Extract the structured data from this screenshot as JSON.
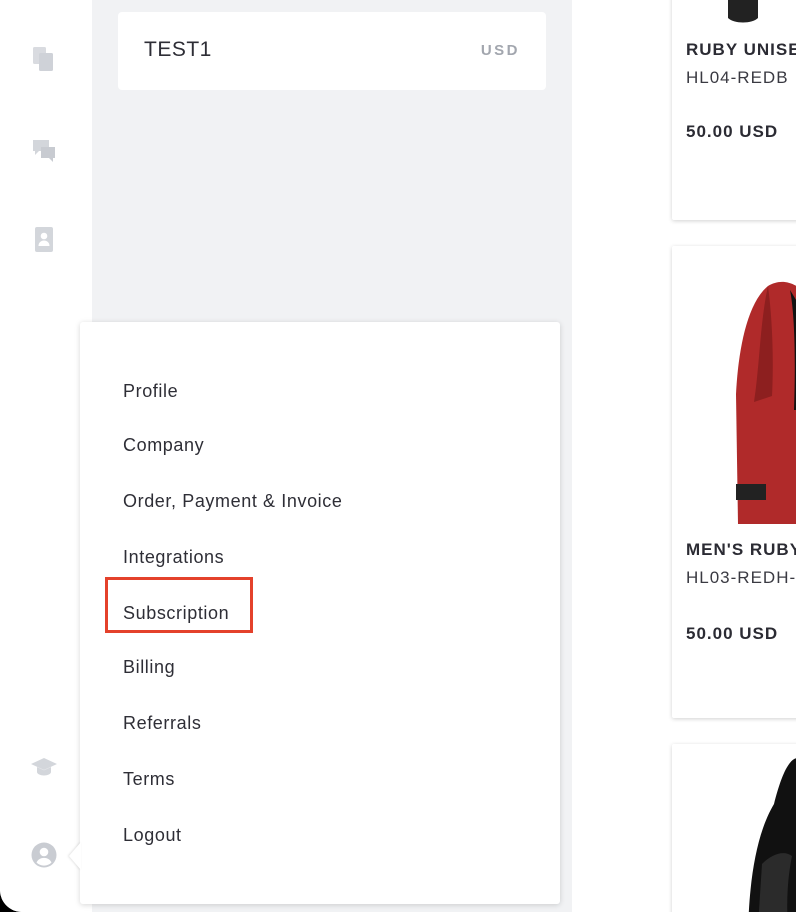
{
  "wallet": {
    "name": "TEST1",
    "currency": "USD"
  },
  "rail_icons": [
    "documents-icon",
    "chat-icon",
    "contact-card-icon",
    "graduation-cap-icon",
    "user-avatar-icon"
  ],
  "menu": {
    "items": [
      {
        "label": "Profile"
      },
      {
        "label": "Company"
      },
      {
        "label": "Order, Payment & Invoice"
      },
      {
        "label": "Integrations"
      },
      {
        "label": "Subscription",
        "highlighted": true
      },
      {
        "label": "Billing"
      },
      {
        "label": "Referrals"
      },
      {
        "label": "Terms"
      },
      {
        "label": "Logout"
      }
    ],
    "highlight_color": "#e4412b"
  },
  "products": [
    {
      "title": "RUBY UNISE",
      "sku": "HL04-REDB",
      "price": "50.00 USD"
    },
    {
      "title": "MEN'S RUBY",
      "sku": "HL03-REDH-",
      "price": "50.00 USD",
      "image_color": "#b02a2a"
    },
    {
      "image_color": "#111111"
    }
  ]
}
